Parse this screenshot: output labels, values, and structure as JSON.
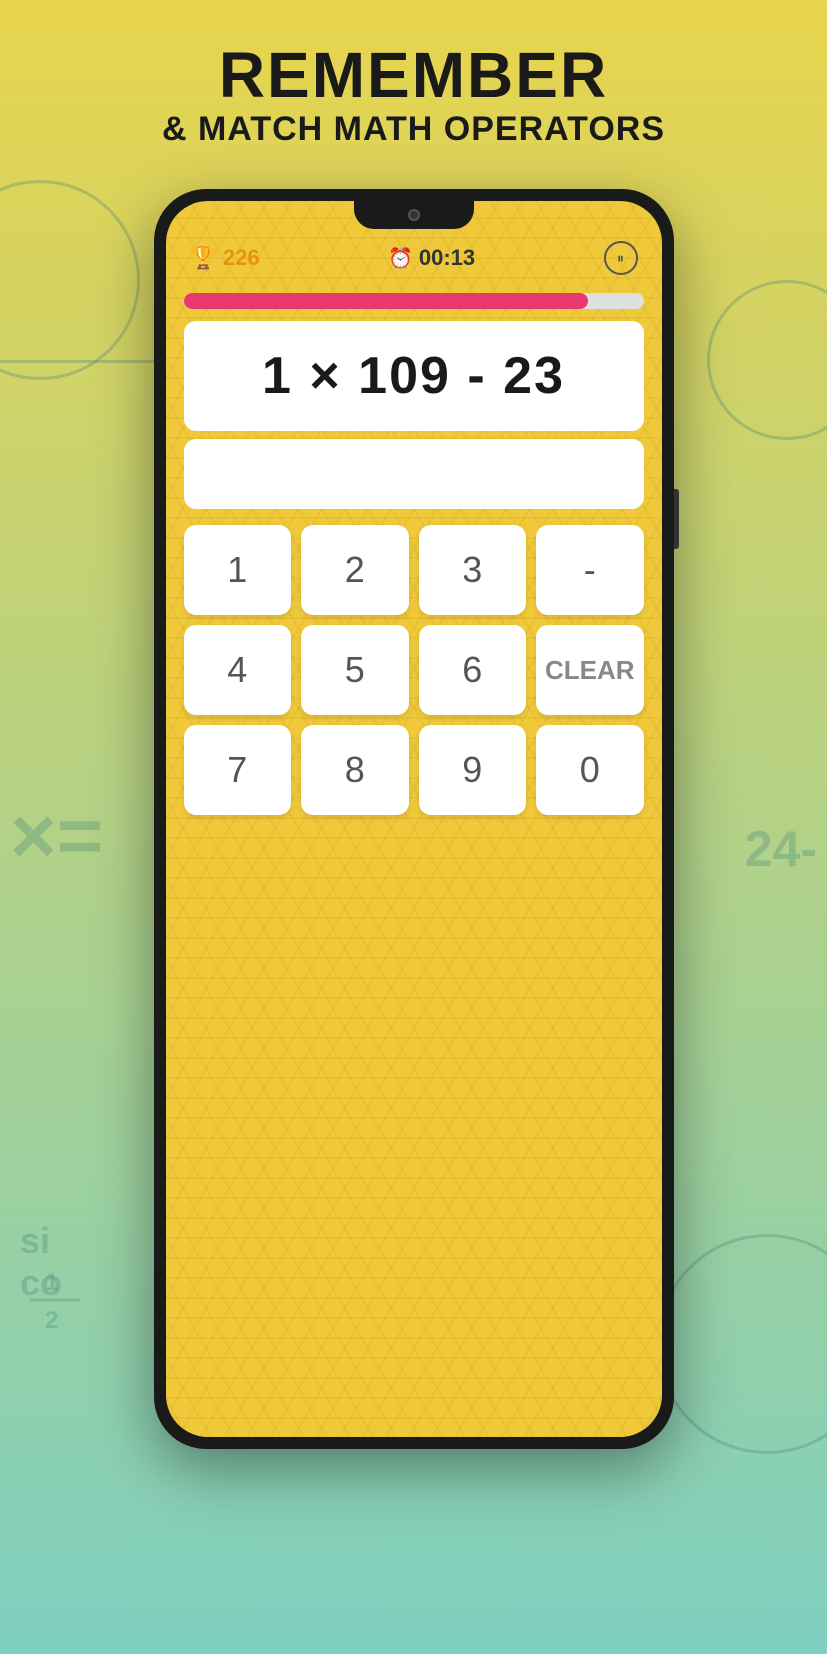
{
  "header": {
    "title": "REMEMBER",
    "subtitle": "& MATCH MATH OPERATORS"
  },
  "status_bar": {
    "score": "226",
    "timer": "00:13",
    "trophy_icon": "🏆",
    "clock_icon": "⏰",
    "pause_label": "⏸"
  },
  "progress": {
    "fill_percent": 88
  },
  "equation": {
    "display": "1 × 109 - 23"
  },
  "answer": {
    "current_value": ""
  },
  "keypad": {
    "buttons": [
      {
        "label": "1",
        "id": "key-1"
      },
      {
        "label": "2",
        "id": "key-2"
      },
      {
        "label": "3",
        "id": "key-3"
      },
      {
        "label": "-",
        "id": "key-minus"
      },
      {
        "label": "4",
        "id": "key-4"
      },
      {
        "label": "5",
        "id": "key-5"
      },
      {
        "label": "6",
        "id": "key-6"
      },
      {
        "label": "CLEAR",
        "id": "key-clear"
      },
      {
        "label": "7",
        "id": "key-7"
      },
      {
        "label": "8",
        "id": "key-8"
      },
      {
        "label": "9",
        "id": "key-9"
      },
      {
        "label": "0",
        "id": "key-0"
      }
    ]
  },
  "background_decorations": {
    "left_equals": "×=",
    "right_number": "24-",
    "bottom_left_text": "si co",
    "fraction_text": "1/2"
  }
}
